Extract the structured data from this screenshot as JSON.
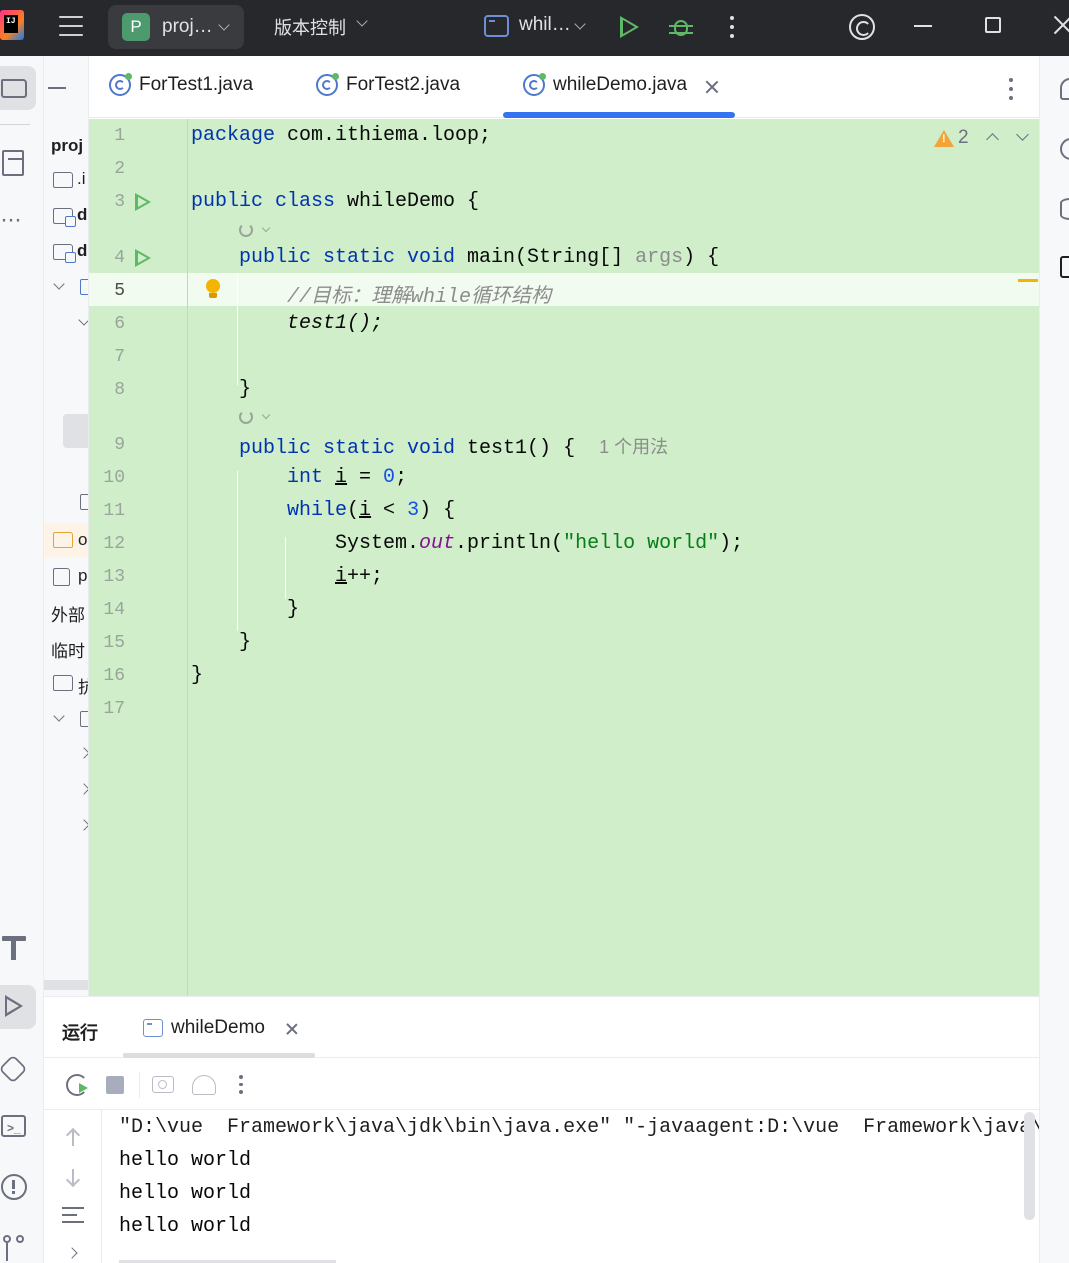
{
  "titlebar": {
    "project_badge": "P",
    "project_name": "proj…",
    "vcs_label": "版本控制",
    "run_config": "whil…"
  },
  "project_panel": {
    "root_label": "proj",
    "items": [
      ".i",
      "d",
      "d",
      "o",
      "p",
      "外部",
      "临时",
      "抗"
    ]
  },
  "tabs": [
    {
      "label": "ForTest1.java"
    },
    {
      "label": "ForTest2.java"
    },
    {
      "label": "whileDemo.java",
      "active": true
    }
  ],
  "editor": {
    "warning_count": "2",
    "current_line": 5,
    "lines": [
      {
        "n": "1",
        "text": "package com.ithiema.loop;"
      },
      {
        "n": "2",
        "text": ""
      },
      {
        "n": "3",
        "text": "public class whileDemo {"
      },
      {
        "n": "4",
        "text": "public static void main(String[] args) {"
      },
      {
        "n": "5",
        "text": "//目标：理解while循环结构"
      },
      {
        "n": "6",
        "text": "test1();"
      },
      {
        "n": "7",
        "text": ""
      },
      {
        "n": "8",
        "text": "}"
      },
      {
        "n": "9",
        "text": "public static void test1() {",
        "usage_hint": "1 个用法"
      },
      {
        "n": "10",
        "text": "int i = 0;"
      },
      {
        "n": "11",
        "text": "while(i < 3) {"
      },
      {
        "n": "12",
        "text": "System.out.println(\"hello world\");"
      },
      {
        "n": "13",
        "text": "i++;"
      },
      {
        "n": "14",
        "text": "}"
      },
      {
        "n": "15",
        "text": "}"
      },
      {
        "n": "16",
        "text": "}"
      },
      {
        "n": "17",
        "text": ""
      }
    ],
    "highlight_color": "#cfeec9"
  },
  "run_panel": {
    "title": "运行",
    "tab_label": "whileDemo",
    "console_lines": [
      "\"D:\\vue  Framework\\java\\jdk\\bin\\java.exe\" \"-javaagent:D:\\vue  Framework\\java\\",
      "hello world",
      "hello world",
      "hello world"
    ]
  },
  "colors": {
    "accent": "#3574f0",
    "run_green": "#5fb865",
    "keyword": "#0033b3",
    "string": "#067d17",
    "number": "#1750eb",
    "comment": "#8c8c8c",
    "field": "#871094",
    "warning": "#f2a33a"
  }
}
